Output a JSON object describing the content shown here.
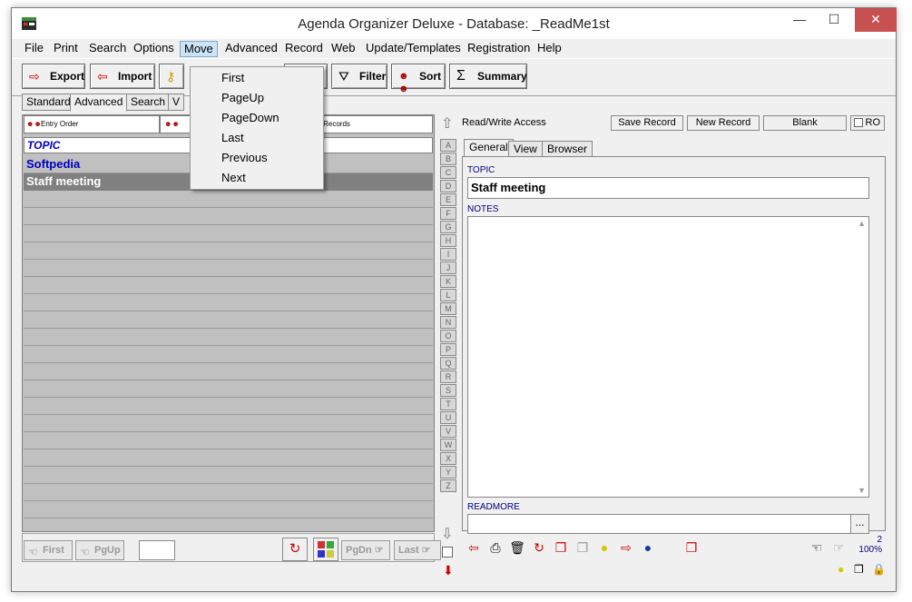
{
  "window": {
    "title": "Agenda Organizer Deluxe - Database: _ReadMe1st",
    "minimize": "—",
    "maximize": "☐",
    "close": "✕"
  },
  "menu": [
    "File",
    "Print",
    "Search",
    "Options",
    "Move",
    "Advanced",
    "Record",
    "Web",
    "Update/Templates",
    "Registration",
    "Help"
  ],
  "toolbar": {
    "export": "Export",
    "import": "Import",
    "replace": "ace",
    "filter": "Filter",
    "sort": "Sort",
    "summary": "Summary"
  },
  "left_tabs": [
    "Standard",
    "Advanced",
    "Search",
    "V"
  ],
  "list": {
    "hdr_entry_order": "Entry Order",
    "hdr_all_records": "All Records",
    "topic_header": "TOPIC",
    "rows": [
      "Softpedia",
      "Staff meeting"
    ]
  },
  "pager": {
    "first": "First",
    "pgup": "PgUp",
    "pgdn": "PgDn",
    "last": "Last"
  },
  "alphabet": [
    "A",
    "B",
    "C",
    "D",
    "E",
    "F",
    "G",
    "H",
    "I",
    "J",
    "K",
    "L",
    "M",
    "N",
    "O",
    "P",
    "Q",
    "R",
    "S",
    "T",
    "U",
    "V",
    "W",
    "X",
    "Y",
    "Z"
  ],
  "record": {
    "access": "Read/Write Access",
    "save": "Save Record",
    "new": "New Record",
    "blank": "Blank",
    "ro": "RO",
    "tabs": [
      "General",
      "View",
      "Browser"
    ],
    "topic_label": "TOPIC",
    "topic_value": "Staff meeting",
    "notes_label": "NOTES",
    "readmore_label": "READMORE",
    "readmore_btn": "...",
    "count": "2",
    "zoom": "100%"
  },
  "move_menu": [
    "First",
    "PageUp",
    "PageDown",
    "Last",
    "Previous",
    "Next"
  ],
  "colors": {
    "accent_blue": "#0000c0",
    "close_red": "#c75050",
    "selected_row": "#808080"
  }
}
